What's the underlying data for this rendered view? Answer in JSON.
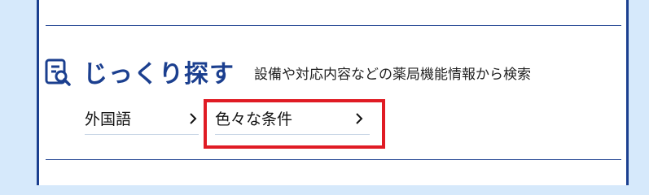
{
  "section": {
    "title": "じっくり探す",
    "subtitle": "設備や対応内容などの薬局機能情報から検索",
    "icon": "search-document-icon"
  },
  "links": [
    {
      "label": "外国語",
      "icon": "chevron-right-icon"
    },
    {
      "label": "色々な条件",
      "icon": "chevron-right-icon",
      "highlighted": true
    }
  ],
  "colors": {
    "accent": "#1b3f8f",
    "highlight": "#e01b24",
    "background": "#d6e9fb"
  }
}
